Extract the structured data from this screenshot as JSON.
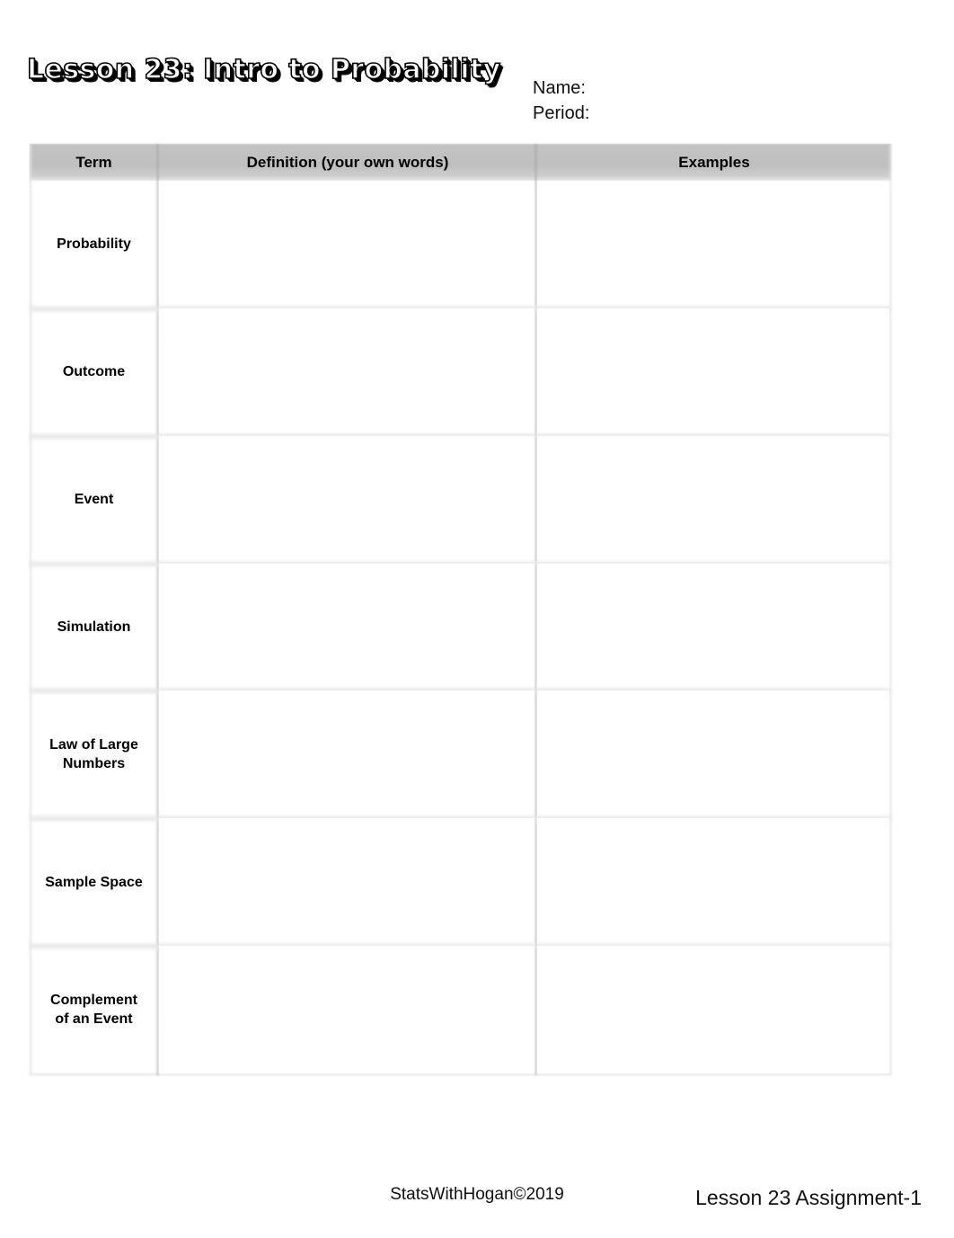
{
  "page": {
    "title": "Lesson 23: Intro to Probability",
    "background_color": "#ffffff"
  },
  "student_fields": {
    "name_label": "Name:",
    "period_label": "Period:"
  },
  "table": {
    "header_background": "#c0c0c0",
    "columns": [
      {
        "label": "Term"
      },
      {
        "label": "Definition (your own words)"
      },
      {
        "label": "Examples"
      }
    ],
    "rows": [
      {
        "term": "Probability",
        "definition": "",
        "examples": ""
      },
      {
        "term": "Outcome",
        "definition": "",
        "examples": ""
      },
      {
        "term": "Event",
        "definition": "",
        "examples": ""
      },
      {
        "term": "Simulation",
        "definition": "",
        "examples": ""
      },
      {
        "term": "Law of Large\nNumbers",
        "definition": "",
        "examples": ""
      },
      {
        "term": "Sample Space",
        "definition": "",
        "examples": ""
      },
      {
        "term": "Complement\nof an Event",
        "definition": "",
        "examples": ""
      }
    ]
  },
  "footer": {
    "copyright": "StatsWithHogan©2019",
    "assignment": "Lesson 23 Assignment-1"
  }
}
